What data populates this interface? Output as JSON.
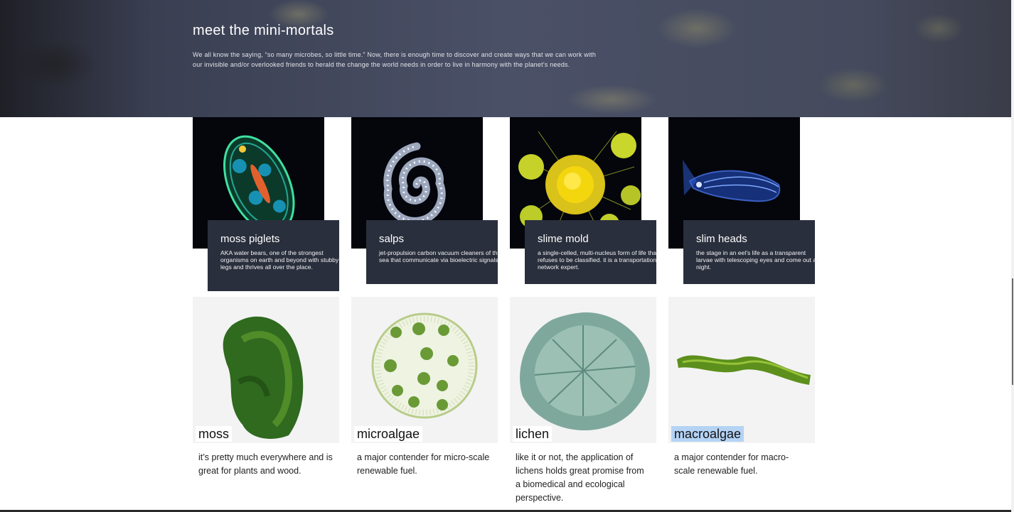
{
  "hero": {
    "title": "meet the mini-mortals",
    "description": "We all know the saying, “so many microbes, so little time.” Now, there is enough time to discover and create ways that we can work with our invisible and/or overlooked friends to herald the change the world needs in order to live in harmony with the planet’s needs."
  },
  "top_cards": [
    {
      "name": "moss piglets",
      "description": "AKA water bears, one of the strongest organisms on earth and beyond with stubby legs and thrives all over the place."
    },
    {
      "name": "salps",
      "description": "jet-propulsion carbon vacuum cleaners of the sea that communicate via bioelectric signals."
    },
    {
      "name": "slime mold",
      "description": "a single-celled, multi-nucleus form of life that refuses to be classified. it is a transportation network expert."
    },
    {
      "name": "slim heads",
      "description": "the stage in an eel’s life as a transparent larvae with telescoping eyes and come out at night."
    }
  ],
  "bottom_cards": [
    {
      "name": "moss",
      "description": "it’s pretty much everywhere and is great for plants and wood."
    },
    {
      "name": "microalgae",
      "description": "a major contender for micro-scale renewable fuel."
    },
    {
      "name": "lichen",
      "description": "like it or not, the application of lichens holds great promise from a biomedical and ecological perspective."
    },
    {
      "name": "macroalgae",
      "description": "a major contender for macro-scale renewable fuel."
    }
  ],
  "colors": {
    "caption_bg": "#2a2f3d",
    "photo_bg": "#04060c",
    "tile_bg": "#f3f3f3",
    "selection": "#b4d3f5"
  }
}
